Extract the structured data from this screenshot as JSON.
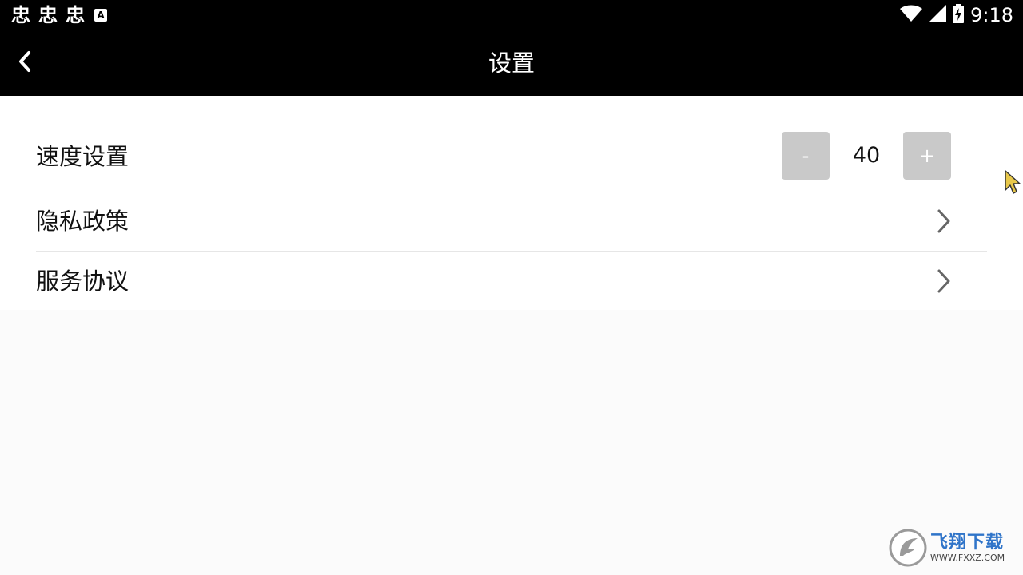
{
  "status_bar": {
    "notification_glyphs": [
      "忠",
      "忠",
      "忠"
    ],
    "notification_a_icon": "A",
    "time": "9:18"
  },
  "header": {
    "title": "设置"
  },
  "settings": {
    "speed": {
      "label": "速度设置",
      "decrement_label": "-",
      "value": "40",
      "increment_label": "+"
    },
    "privacy": {
      "label": "隐私政策"
    },
    "service": {
      "label": "服务协议"
    }
  },
  "watermark": {
    "text": "飞翔下载",
    "url": "WWW.FXXZ.COM"
  },
  "colors": {
    "bar_background": "#000000",
    "content_background": "#ffffff",
    "page_background": "#fbfbfb",
    "stepper_button": "#c9c9c9",
    "divider": "#e6e6e6"
  },
  "icons": {
    "back": "chevron-left-icon",
    "row_arrow": "chevron-right-icon",
    "wifi": "wifi-icon",
    "cell": "cell-signal-icon",
    "battery": "battery-charging-icon"
  }
}
